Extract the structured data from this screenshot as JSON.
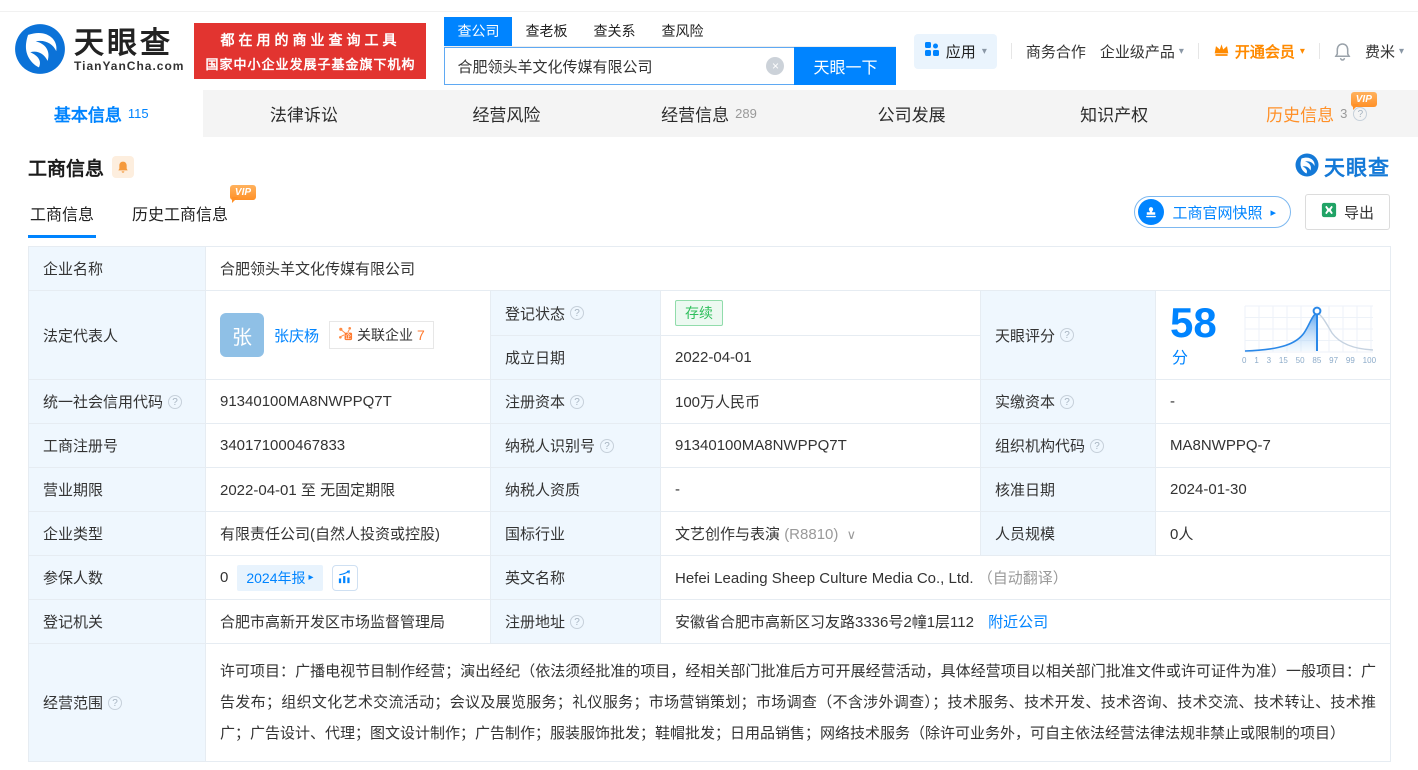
{
  "icons": {
    "caret": "▾",
    "arrow_right": "▸",
    "help": "?",
    "close": "×",
    "industry_caret": "∨",
    "vip": "VIP"
  },
  "colors": {
    "primary": "#0084ff",
    "banner_red": "#e23430",
    "vip_orange": "#ff8a00",
    "status_green": "#2fbf5c"
  },
  "header": {
    "logo": {
      "brand": "天眼查",
      "domain": "TianYanCha.com"
    },
    "banner": {
      "line1": "都在用的商业查询工具",
      "line2": "国家中小企业发展子基金旗下机构"
    },
    "search": {
      "tabs": [
        {
          "label": "查公司"
        },
        {
          "label": "查老板"
        },
        {
          "label": "查关系"
        },
        {
          "label": "查风险"
        }
      ],
      "value": "合肥领头羊文化传媒有限公司",
      "button": "天眼一下"
    },
    "menu": {
      "apps": "应用",
      "cooperation": "商务合作",
      "enterprise": "企业级产品",
      "vip": "开通会员",
      "user": "费米"
    }
  },
  "nav_tabs": [
    {
      "label": "基本信息",
      "count": "115"
    },
    {
      "label": "法律诉讼",
      "count": ""
    },
    {
      "label": "经营风险",
      "count": ""
    },
    {
      "label": "经营信息",
      "count": "289"
    },
    {
      "label": "公司发展",
      "count": ""
    },
    {
      "label": "知识产权",
      "count": ""
    },
    {
      "label": "历史信息",
      "count": "3"
    }
  ],
  "section": {
    "title": "工商信息",
    "watermark": "天眼查"
  },
  "sub_tabs": {
    "current": "工商信息",
    "history": "历史工商信息"
  },
  "actions": {
    "snapshot": "工商官网快照",
    "export": "导出"
  },
  "table": {
    "company_name_label": "企业名称",
    "company_name": "合肥领头羊文化传媒有限公司",
    "legal_rep_label": "法定代表人",
    "legal_rep_avatar": "张",
    "legal_rep_name": "张庆杨",
    "related_badge": "关联企业",
    "related_count": "7",
    "reg_status_label": "登记状态",
    "reg_status": "存续",
    "establish_date_label": "成立日期",
    "establish_date": "2022-04-01",
    "score_label": "天眼评分",
    "score": "58",
    "score_unit": "分",
    "score_axis": [
      "0",
      "1",
      "3",
      "15",
      "50",
      "85",
      "97",
      "99",
      "100"
    ],
    "credit_code_label": "统一社会信用代码",
    "credit_code": "91340100MA8NWPPQ7T",
    "reg_capital_label": "注册资本",
    "reg_capital": "100万人民币",
    "paid_capital_label": "实缴资本",
    "paid_capital": "-",
    "reg_number_label": "工商注册号",
    "reg_number": "340171000467833",
    "taxpayer_id_label": "纳税人识别号",
    "taxpayer_id": "91340100MA8NWPPQ7T",
    "org_code_label": "组织机构代码",
    "org_code": "MA8NWPPQ-7",
    "business_term_label": "营业期限",
    "business_term": "2022-04-01 至 无固定期限",
    "taxpayer_quality_label": "纳税人资质",
    "taxpayer_quality": "-",
    "approval_date_label": "核准日期",
    "approval_date": "2024-01-30",
    "company_type_label": "企业类型",
    "company_type": "有限责任公司(自然人投资或控股)",
    "industry_label": "国标行业",
    "industry": "文艺创作与表演",
    "industry_code": "(R8810)",
    "staff_size_label": "人员规模",
    "staff_size": "0人",
    "insured_label": "参保人数",
    "insured": "0",
    "annual_report_badge": "2024年报",
    "english_name_label": "英文名称",
    "english_name": "Hefei Leading Sheep Culture Media Co., Ltd.",
    "english_name_note": "（自动翻译）",
    "registry_label": "登记机关",
    "registry": "合肥市高新开发区市场监督管理局",
    "address_label": "注册地址",
    "address": "安徽省合肥市高新区习友路3336号2幢1层112",
    "nearby_link": "附近公司",
    "scope_label": "经营范围",
    "scope": "许可项目：广播电视节目制作经营；演出经纪（依法须经批准的项目，经相关部门批准后方可开展经营活动，具体经营项目以相关部门批准文件或许可证件为准）一般项目：广告发布；组织文化艺术交流活动；会议及展览服务；礼仪服务；市场营销策划；市场调查（不含涉外调查）；技术服务、技术开发、技术咨询、技术交流、技术转让、技术推广；广告设计、代理；图文设计制作；广告制作；服装服饰批发；鞋帽批发；日用品销售；网络技术服务（除许可业务外，可自主依法经营法律法规非禁止或限制的项目）"
  }
}
